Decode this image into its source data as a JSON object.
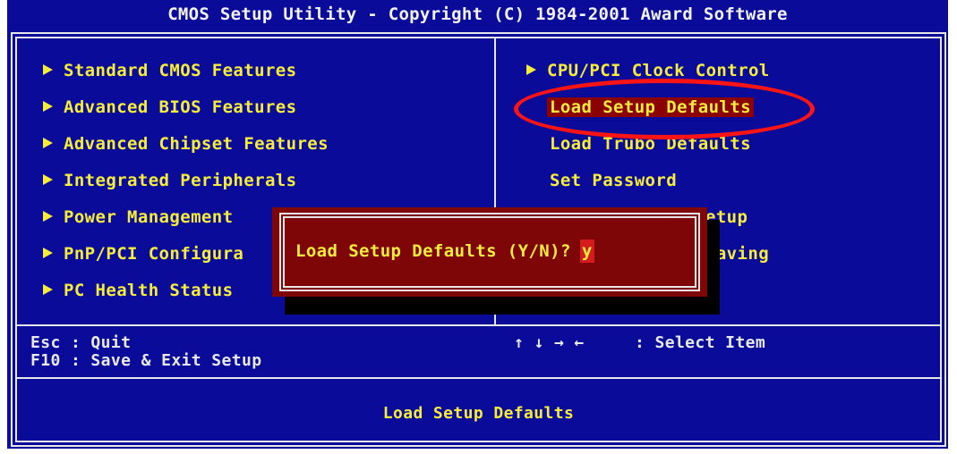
{
  "title": "CMOS Setup Utility - Copyright (C) 1984-2001 Award Software",
  "left_menu": [
    {
      "label": "Standard CMOS Features"
    },
    {
      "label": "Advanced BIOS Features"
    },
    {
      "label": "Advanced Chipset Features"
    },
    {
      "label": "Integrated Peripherals"
    },
    {
      "label": "Power Management"
    },
    {
      "label": "PnP/PCI Configura"
    },
    {
      "label": "PC Health Status"
    }
  ],
  "right_menu": [
    {
      "label": "CPU/PCI Clock Control"
    },
    {
      "label": "Load Setup Defaults"
    },
    {
      "label": "Load Trubo Defaults"
    },
    {
      "label": "Set Password"
    },
    {
      "label": "etup"
    },
    {
      "label": "Saving"
    }
  ],
  "dialog": {
    "prompt": "Load Setup Defaults (Y/N)?",
    "input": "y"
  },
  "help": {
    "esc": "Esc : Quit",
    "f10": "F10 : Save & Exit Setup",
    "arrows": "↑ ↓ → ←",
    "select": ": Select Item"
  },
  "description": "Load Setup Defaults",
  "colors": {
    "background": "#0b0b9a",
    "text": "#f5ec3c",
    "highlight": "#8b0000",
    "dialog": "#7e0606",
    "annotation": "#ff1414"
  }
}
